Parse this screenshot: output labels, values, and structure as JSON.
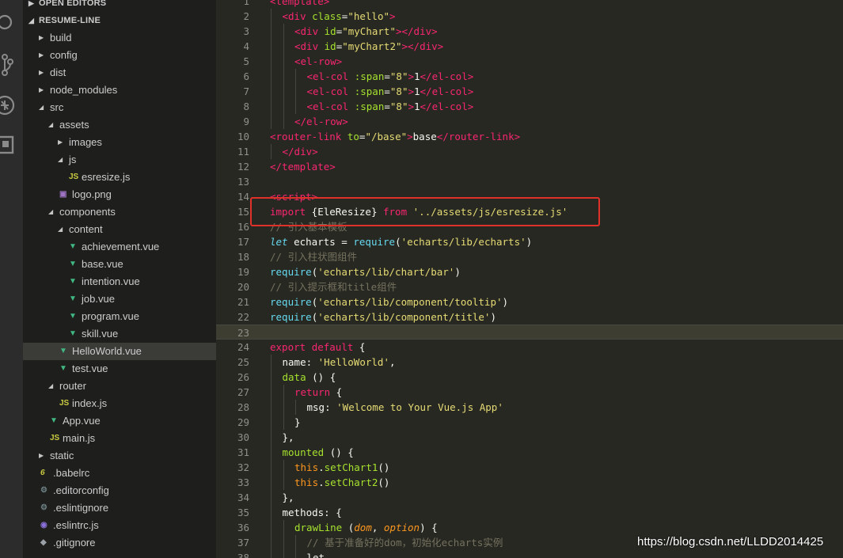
{
  "explorer": {
    "open_editors": "OPEN EDITORS",
    "project": "RESUME-LINE",
    "items": [
      {
        "label": "build",
        "depth": 0,
        "type": "folder",
        "expanded": false
      },
      {
        "label": "config",
        "depth": 0,
        "type": "folder",
        "expanded": false
      },
      {
        "label": "dist",
        "depth": 0,
        "type": "folder",
        "expanded": false
      },
      {
        "label": "node_modules",
        "depth": 0,
        "type": "folder",
        "expanded": false
      },
      {
        "label": "src",
        "depth": 0,
        "type": "folder",
        "expanded": true
      },
      {
        "label": "assets",
        "depth": 1,
        "type": "folder",
        "expanded": true
      },
      {
        "label": "images",
        "depth": 2,
        "type": "folder",
        "expanded": false
      },
      {
        "label": "js",
        "depth": 2,
        "type": "folder",
        "expanded": true
      },
      {
        "label": "esresize.js",
        "depth": 3,
        "type": "js"
      },
      {
        "label": "logo.png",
        "depth": 2,
        "type": "img"
      },
      {
        "label": "components",
        "depth": 1,
        "type": "folder",
        "expanded": true
      },
      {
        "label": "content",
        "depth": 2,
        "type": "folder",
        "expanded": true
      },
      {
        "label": "achievement.vue",
        "depth": 3,
        "type": "vue"
      },
      {
        "label": "base.vue",
        "depth": 3,
        "type": "vue"
      },
      {
        "label": "intention.vue",
        "depth": 3,
        "type": "vue"
      },
      {
        "label": "job.vue",
        "depth": 3,
        "type": "vue"
      },
      {
        "label": "program.vue",
        "depth": 3,
        "type": "vue"
      },
      {
        "label": "skill.vue",
        "depth": 3,
        "type": "vue"
      },
      {
        "label": "HelloWorld.vue",
        "depth": 2,
        "type": "vue",
        "selected": true
      },
      {
        "label": "test.vue",
        "depth": 2,
        "type": "vue"
      },
      {
        "label": "router",
        "depth": 1,
        "type": "folder",
        "expanded": true
      },
      {
        "label": "index.js",
        "depth": 2,
        "type": "js"
      },
      {
        "label": "App.vue",
        "depth": 1,
        "type": "vue"
      },
      {
        "label": "main.js",
        "depth": 1,
        "type": "js"
      },
      {
        "label": "static",
        "depth": 0,
        "type": "folder",
        "expanded": false
      },
      {
        "label": ".babelrc",
        "depth": 0,
        "type": "babel"
      },
      {
        "label": ".editorconfig",
        "depth": 0,
        "type": "gear"
      },
      {
        "label": ".eslintignore",
        "depth": 0,
        "type": "gear"
      },
      {
        "label": ".eslintrc.js",
        "depth": 0,
        "type": "eslint"
      },
      {
        "label": ".gitignore",
        "depth": 0,
        "type": "git"
      }
    ]
  },
  "editor": {
    "current_line": 23,
    "highlighted_line": 15,
    "lines": [
      {
        "n": "1",
        "indent": 0,
        "tokens": [
          [
            "tag",
            "<template>"
          ]
        ]
      },
      {
        "n": "2",
        "indent": 1,
        "tokens": [
          [
            "tag",
            "<div"
          ],
          [
            "plain",
            " "
          ],
          [
            "attr",
            "class"
          ],
          [
            "plain",
            "="
          ],
          [
            "str",
            "\"hello\""
          ],
          [
            "tag",
            ">"
          ]
        ]
      },
      {
        "n": "3",
        "indent": 2,
        "tokens": [
          [
            "tag",
            "<div"
          ],
          [
            "plain",
            " "
          ],
          [
            "attr",
            "id"
          ],
          [
            "plain",
            "="
          ],
          [
            "str",
            "\"myChart\""
          ],
          [
            "tag",
            "></div>"
          ]
        ]
      },
      {
        "n": "4",
        "indent": 2,
        "tokens": [
          [
            "tag",
            "<div"
          ],
          [
            "plain",
            " "
          ],
          [
            "attr",
            "id"
          ],
          [
            "plain",
            "="
          ],
          [
            "str",
            "\"myChart2\""
          ],
          [
            "tag",
            "></div>"
          ]
        ]
      },
      {
        "n": "5",
        "indent": 2,
        "tokens": [
          [
            "tag",
            "<el-row>"
          ]
        ]
      },
      {
        "n": "6",
        "indent": 3,
        "tokens": [
          [
            "tag",
            "<el-col"
          ],
          [
            "plain",
            " "
          ],
          [
            "attr",
            ":span"
          ],
          [
            "plain",
            "="
          ],
          [
            "str",
            "\"8\""
          ],
          [
            "tag",
            ">"
          ],
          [
            "plain",
            "1"
          ],
          [
            "tag",
            "</el-col>"
          ]
        ]
      },
      {
        "n": "7",
        "indent": 3,
        "tokens": [
          [
            "tag",
            "<el-col"
          ],
          [
            "plain",
            " "
          ],
          [
            "attr",
            ":span"
          ],
          [
            "plain",
            "="
          ],
          [
            "str",
            "\"8\""
          ],
          [
            "tag",
            ">"
          ],
          [
            "plain",
            "1"
          ],
          [
            "tag",
            "</el-col>"
          ]
        ]
      },
      {
        "n": "8",
        "indent": 3,
        "tokens": [
          [
            "tag",
            "<el-col"
          ],
          [
            "plain",
            " "
          ],
          [
            "attr",
            ":span"
          ],
          [
            "plain",
            "="
          ],
          [
            "str",
            "\"8\""
          ],
          [
            "tag",
            ">"
          ],
          [
            "plain",
            "1"
          ],
          [
            "tag",
            "</el-col>"
          ]
        ]
      },
      {
        "n": "9",
        "indent": 2,
        "tokens": [
          [
            "tag",
            "</el-row>"
          ]
        ]
      },
      {
        "n": "10",
        "indent": 0,
        "tokens": [
          [
            "tag",
            "<router-link"
          ],
          [
            "plain",
            " "
          ],
          [
            "attr",
            "to"
          ],
          [
            "plain",
            "="
          ],
          [
            "str",
            "\"/base\""
          ],
          [
            "tag",
            ">"
          ],
          [
            "plain",
            "base"
          ],
          [
            "tag",
            "</router-link>"
          ]
        ]
      },
      {
        "n": "11",
        "indent": 1,
        "tokens": [
          [
            "tag",
            "</div>"
          ]
        ]
      },
      {
        "n": "12",
        "indent": 0,
        "tokens": [
          [
            "tag",
            "</template>"
          ]
        ]
      },
      {
        "n": "13",
        "indent": 0,
        "tokens": []
      },
      {
        "n": "14",
        "indent": 0,
        "tokens": [
          [
            "tag",
            "<script>"
          ]
        ]
      },
      {
        "n": "15",
        "indent": 0,
        "tokens": [
          [
            "kw",
            "import"
          ],
          [
            "plain",
            " {EleResize} "
          ],
          [
            "kw",
            "from"
          ],
          [
            "plain",
            " "
          ],
          [
            "str",
            "'../assets/js/esresize.js'"
          ]
        ]
      },
      {
        "n": "16",
        "indent": 0,
        "tokens": [
          [
            "cmt",
            "// 引入基本模板"
          ]
        ]
      },
      {
        "n": "17",
        "indent": 0,
        "tokens": [
          [
            "kwi",
            "let"
          ],
          [
            "plain",
            " echarts = "
          ],
          [
            "fn",
            "require"
          ],
          [
            "plain",
            "("
          ],
          [
            "str",
            "'echarts/lib/echarts'"
          ],
          [
            "plain",
            ")"
          ]
        ]
      },
      {
        "n": "18",
        "indent": 0,
        "tokens": [
          [
            "cmt",
            "// 引入柱状图组件"
          ]
        ]
      },
      {
        "n": "19",
        "indent": 0,
        "tokens": [
          [
            "fn",
            "require"
          ],
          [
            "plain",
            "("
          ],
          [
            "str",
            "'echarts/lib/chart/bar'"
          ],
          [
            "plain",
            ")"
          ]
        ]
      },
      {
        "n": "20",
        "indent": 0,
        "tokens": [
          [
            "cmt",
            "// 引入提示框和title组件"
          ]
        ]
      },
      {
        "n": "21",
        "indent": 0,
        "tokens": [
          [
            "fn",
            "require"
          ],
          [
            "plain",
            "("
          ],
          [
            "str",
            "'echarts/lib/component/tooltip'"
          ],
          [
            "plain",
            ")"
          ]
        ]
      },
      {
        "n": "22",
        "indent": 0,
        "tokens": [
          [
            "fn",
            "require"
          ],
          [
            "plain",
            "("
          ],
          [
            "str",
            "'echarts/lib/component/title'"
          ],
          [
            "plain",
            ")"
          ]
        ]
      },
      {
        "n": "23",
        "indent": 0,
        "tokens": []
      },
      {
        "n": "24",
        "indent": 0,
        "tokens": [
          [
            "kw",
            "export"
          ],
          [
            "plain",
            " "
          ],
          [
            "kw",
            "default"
          ],
          [
            "plain",
            " {"
          ]
        ]
      },
      {
        "n": "25",
        "indent": 1,
        "tokens": [
          [
            "plain",
            "name: "
          ],
          [
            "str",
            "'HelloWorld'"
          ],
          [
            "plain",
            ","
          ]
        ]
      },
      {
        "n": "26",
        "indent": 1,
        "tokens": [
          [
            "fn2",
            "data"
          ],
          [
            "plain",
            " () {"
          ]
        ]
      },
      {
        "n": "27",
        "indent": 2,
        "tokens": [
          [
            "kw",
            "return"
          ],
          [
            "plain",
            " {"
          ]
        ]
      },
      {
        "n": "28",
        "indent": 3,
        "tokens": [
          [
            "plain",
            "msg: "
          ],
          [
            "str",
            "'Welcome to Your Vue.js App'"
          ]
        ]
      },
      {
        "n": "29",
        "indent": 2,
        "tokens": [
          [
            "plain",
            "}"
          ]
        ]
      },
      {
        "n": "30",
        "indent": 1,
        "tokens": [
          [
            "plain",
            "},"
          ]
        ]
      },
      {
        "n": "31",
        "indent": 1,
        "tokens": [
          [
            "fn2",
            "mounted"
          ],
          [
            "plain",
            " () {"
          ]
        ]
      },
      {
        "n": "32",
        "indent": 2,
        "tokens": [
          [
            "this",
            "this"
          ],
          [
            "plain",
            "."
          ],
          [
            "fn2",
            "setChart1"
          ],
          [
            "plain",
            "()"
          ]
        ]
      },
      {
        "n": "33",
        "indent": 2,
        "tokens": [
          [
            "this",
            "this"
          ],
          [
            "plain",
            "."
          ],
          [
            "fn2",
            "setChart2"
          ],
          [
            "plain",
            "()"
          ]
        ]
      },
      {
        "n": "34",
        "indent": 1,
        "tokens": [
          [
            "plain",
            "},"
          ]
        ]
      },
      {
        "n": "35",
        "indent": 1,
        "tokens": [
          [
            "plain",
            "methods: {"
          ]
        ]
      },
      {
        "n": "36",
        "indent": 2,
        "tokens": [
          [
            "fn2",
            "drawLine"
          ],
          [
            "plain",
            " ("
          ],
          [
            "param",
            "dom"
          ],
          [
            "plain",
            ", "
          ],
          [
            "param",
            "option"
          ],
          [
            "plain",
            ") {"
          ]
        ]
      },
      {
        "n": "37",
        "indent": 3,
        "tokens": [
          [
            "cmt",
            "// 基于准备好的dom，初始化echarts实例"
          ]
        ]
      },
      {
        "n": "38",
        "indent": 3,
        "tokens": [
          [
            "plain",
            "let"
          ]
        ]
      }
    ]
  },
  "watermark": "https://blog.csdn.net/LLDD2014425",
  "icons": {
    "activity": [
      "search-icon",
      "source-control-icon",
      "debug-icon",
      "extensions-icon"
    ]
  }
}
